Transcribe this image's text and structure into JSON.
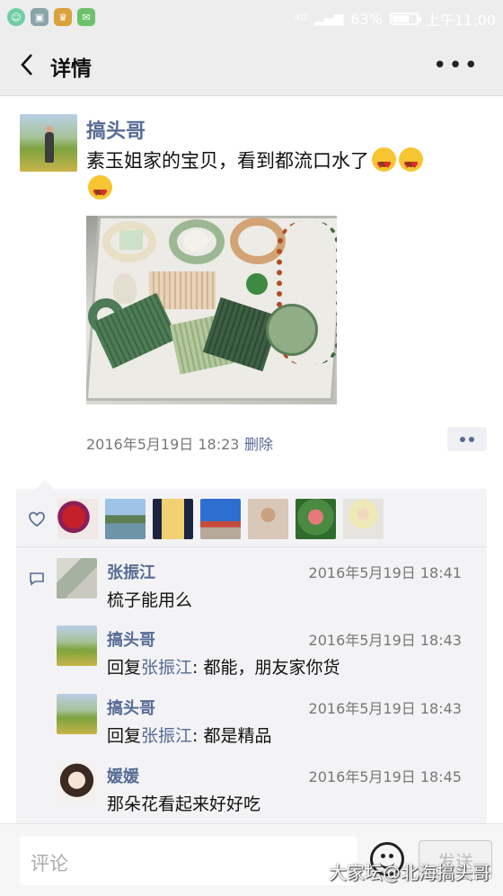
{
  "status_bar": {
    "network": "4G",
    "battery": "63%",
    "battery_level": 0.63,
    "time": "上午11:00"
  },
  "header": {
    "back_icon": "chevron-left-icon",
    "title": "详情",
    "more_icon": "more-dots-icon"
  },
  "post": {
    "author": "搞头哥",
    "text": "素玉姐家的宝贝，看到都流口水了",
    "emoji": "heart-eyes-emoji",
    "timestamp": "2016年5月19日 18:23",
    "delete_label": "删除",
    "action_icon": "two-dots-icon"
  },
  "likes": {
    "icon": "heart-outline-icon",
    "count": 7
  },
  "comments": [
    {
      "name": "张振江",
      "time": "2016年5月19日 18:41",
      "text": "梳子能用么",
      "reply_to": "",
      "reply_prefix": "",
      "reply_suffix": ""
    },
    {
      "name": "搞头哥",
      "time": "2016年5月19日 18:43",
      "text": "",
      "reply_prefix": "回复",
      "reply_to": "张振江",
      "reply_suffix": ": 都能，朋友家你货"
    },
    {
      "name": "搞头哥",
      "time": "2016年5月19日 18:43",
      "text": "",
      "reply_prefix": "回复",
      "reply_to": "张振江",
      "reply_suffix": ": 都是精品"
    },
    {
      "name": "媛媛",
      "time": "2016年5月19日 18:45",
      "text": "那朵花看起来好好吃",
      "reply_to": "",
      "reply_prefix": "",
      "reply_suffix": ""
    }
  ],
  "comment_bar": {
    "placeholder": "评论",
    "emoji_icon": "smiley-icon",
    "send_label": "发送"
  },
  "watermark": "大家坛@北海搞头哥"
}
